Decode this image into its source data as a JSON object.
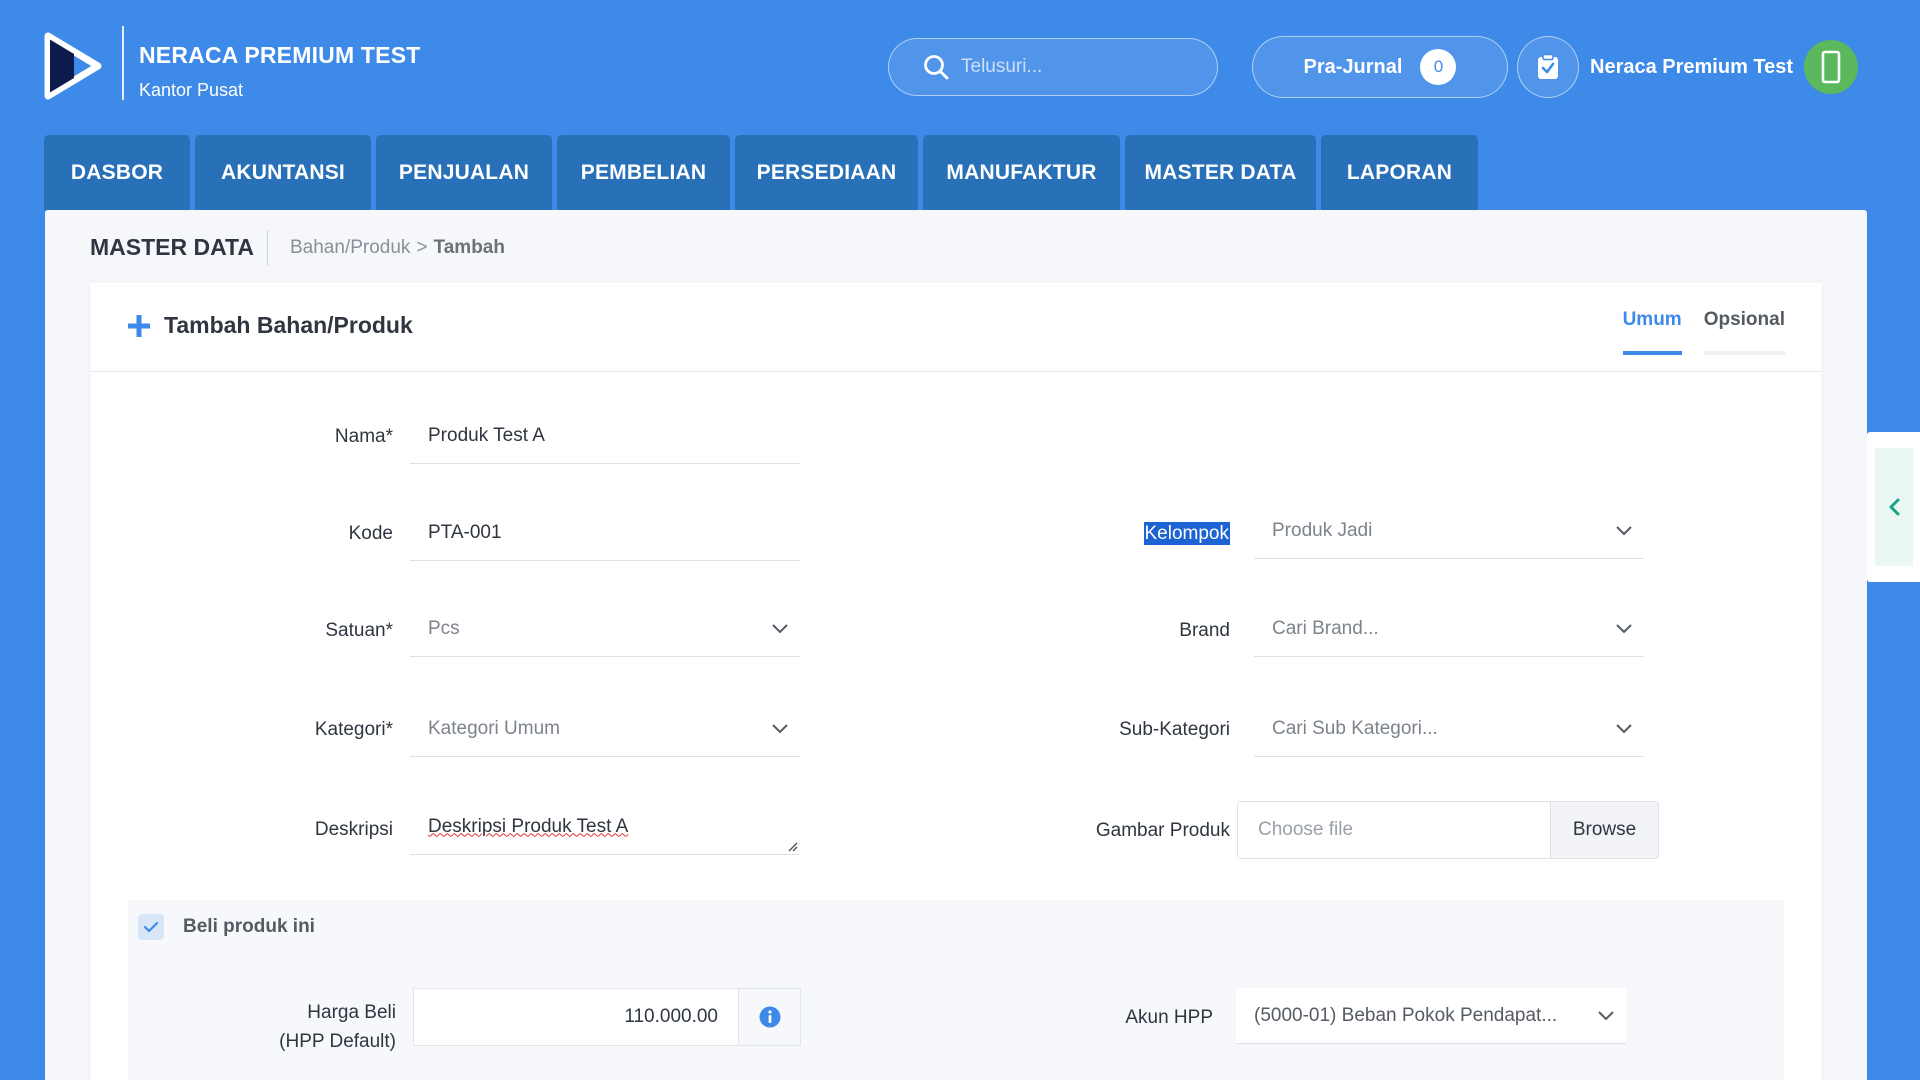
{
  "header": {
    "company_name": "NERACA PREMIUM TEST",
    "branch": "Kantor Pusat",
    "search_placeholder": "Telusuri...",
    "prajurnal_label": "Pra-Jurnal",
    "prajurnal_count": "0",
    "user_name": "Neraca Premium Test"
  },
  "nav": {
    "tabs": [
      "DASBOR",
      "AKUNTANSI",
      "PENJUALAN",
      "PEMBELIAN",
      "PERSEDIAAN",
      "MANUFAKTUR",
      "MASTER DATA",
      "LAPORAN"
    ]
  },
  "breadcrumb": {
    "section": "MASTER DATA",
    "parent": "Bahan/Produk",
    "separator": ">",
    "current": "Tambah"
  },
  "card": {
    "title": "Tambah Bahan/Produk",
    "tabs": [
      "Umum",
      "Opsional"
    ],
    "active_tab": "Umum"
  },
  "form": {
    "nama_label": "Nama*",
    "nama_value": "Produk Test A",
    "kode_label": "Kode",
    "kode_value": "PTA-001",
    "satuan_label": "Satuan*",
    "satuan_value": "Pcs",
    "kategori_label": "Kategori*",
    "kategori_value": "Kategori Umum",
    "deskripsi_label": "Deskripsi",
    "deskripsi_value": "Deskripsi Produk Test A",
    "kelompok_label": "Kelompok",
    "kelompok_value": "Produk Jadi",
    "brand_label": "Brand",
    "brand_placeholder": "Cari Brand...",
    "subkategori_label": "Sub-Kategori",
    "subkategori_placeholder": "Cari Sub Kategori...",
    "gambar_label": "Gambar Produk",
    "file_placeholder": "Choose file",
    "browse_label": "Browse"
  },
  "beli": {
    "checkbox_label": "Beli produk ini",
    "checked": true,
    "harga_label_line1": "Harga Beli",
    "harga_label_line2": "(HPP Default)",
    "harga_value": "110.000.00",
    "akun_hpp_label": "Akun HPP",
    "akun_hpp_value": "(5000-01) Beban Pokok Pendapat..."
  },
  "colors": {
    "primary": "#3d8ae8",
    "nav_tab": "#2870b8",
    "avatar": "#5cb85c",
    "selection": "#1e63d3"
  }
}
